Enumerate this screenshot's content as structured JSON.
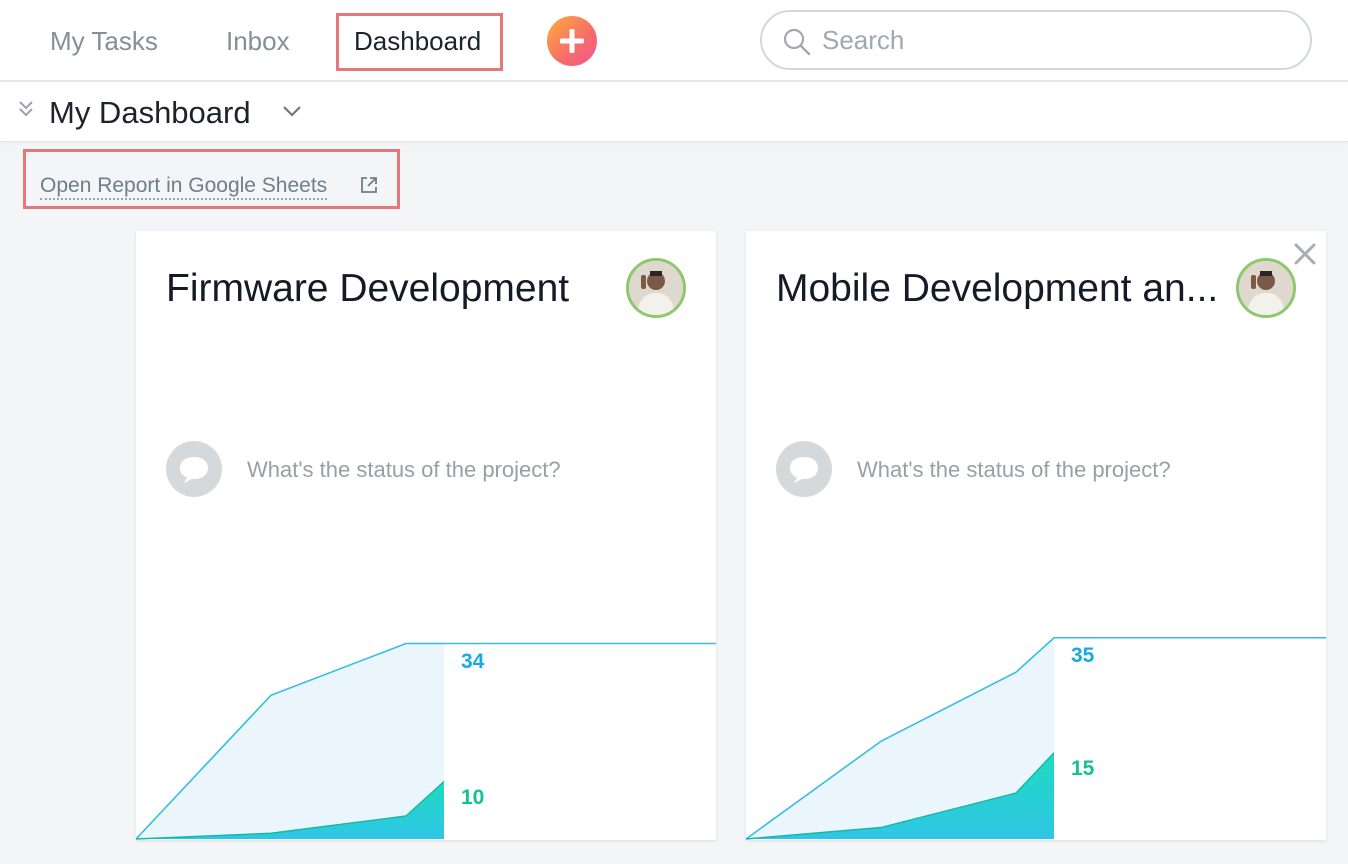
{
  "nav": {
    "tabs": [
      {
        "label": "My Tasks",
        "active": false
      },
      {
        "label": "Inbox",
        "active": false
      },
      {
        "label": "Dashboard",
        "active": true
      }
    ],
    "add_button_icon": "plus-icon",
    "search": {
      "placeholder": "Search",
      "value": ""
    }
  },
  "header": {
    "title": "My Dashboard"
  },
  "report_link": {
    "label": "Open Report in Google Sheets",
    "icon": "external-link-icon"
  },
  "colors": {
    "accent_highlight": "#e5787a",
    "total_line": "#36bde0",
    "total_fill": "#ebf6fc",
    "completed_fill": "#22d2c6",
    "total_label": "#1aa9e1",
    "completed_label": "#14c196"
  },
  "cards": [
    {
      "title": "Firmware Development",
      "status_prompt": "What's the status of the project?",
      "has_close": false,
      "chart_data": {
        "type": "area",
        "series": [
          {
            "values": [
              0,
              25,
              34,
              34
            ]
          },
          {
            "values": [
              0,
              1,
              4,
              10
            ]
          }
        ],
        "labels": {
          "total": "34",
          "completed": "10"
        },
        "ylim": [
          0,
          40
        ]
      }
    },
    {
      "title": "Mobile Development an...",
      "status_prompt": "What's the status of the project?",
      "has_close": true,
      "chart_data": {
        "type": "area",
        "series": [
          {
            "values": [
              0,
              17,
              29,
              35
            ]
          },
          {
            "values": [
              0,
              2,
              8,
              15
            ]
          }
        ],
        "labels": {
          "total": "35",
          "completed": "15"
        },
        "ylim": [
          0,
          40
        ]
      }
    }
  ]
}
